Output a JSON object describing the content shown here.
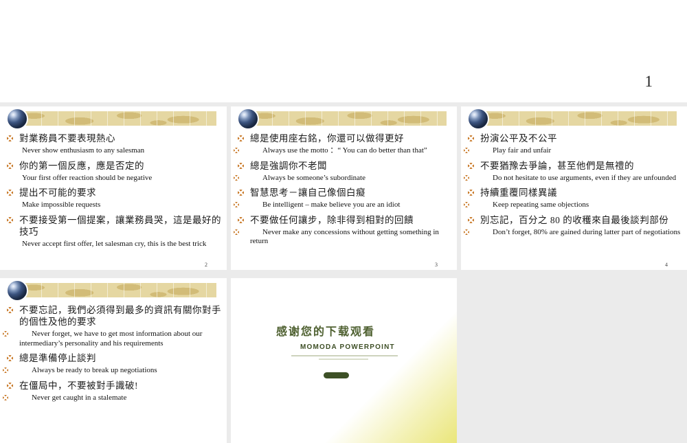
{
  "page": {
    "top_page_number": "1",
    "background_color": "#ebebeb"
  },
  "slides": [
    {
      "page_number": "2",
      "english_bullets": false,
      "items": [
        {
          "zh": "對業務員不要表現熱心",
          "en": "Never show enthusiasm to any salesman"
        },
        {
          "zh": "你的第一個反應，應是否定的",
          "en": "Your first offer reaction should be negative"
        },
        {
          "zh": "提出不可能的要求",
          "en": "Make impossible requests"
        },
        {
          "zh": "不要接受第一個提案，讓業務員哭，這是最好的技巧",
          "en": "Never accept first offer, let salesman cry, this is the best trick"
        }
      ]
    },
    {
      "page_number": "3",
      "english_bullets": true,
      "items": [
        {
          "zh": "總是使用座右銘，你還可以做得更好",
          "en": "Always use the motto ：“ You can do better than that”"
        },
        {
          "zh": "總是強調你不老闆",
          "en": "Always be someone’s subordinate"
        },
        {
          "zh": "智慧思考－讓自己像個白癡",
          "en": "Be intelligent – make believe you are an idiot"
        },
        {
          "zh": "不要做任何讓步，除非得到相對的回饋",
          "en": "Never make any concessions without getting something in return"
        }
      ]
    },
    {
      "page_number": "4",
      "english_bullets": true,
      "items": [
        {
          "zh": "扮演公平及不公平",
          "en": "Play fair and unfair"
        },
        {
          "zh": "不要猶豫去爭論，甚至他們是無禮的",
          "en": "Do not hesitate to use arguments, even if they are unfounded"
        },
        {
          "zh": "持續重覆同樣異議",
          "en": "Keep repeating same objections"
        },
        {
          "zh": "別忘記，百分之 80 的收穫來自最後談判部份",
          "en": "Don’t forget, 80% are gained during latter part of negotiations"
        }
      ]
    },
    {
      "page_number": "",
      "english_bullets": true,
      "items": [
        {
          "zh": "不要忘記，我們必須得到最多的資訊有關你對手的個性及他的要求",
          "en": "Never forget, we have to get most information about our intermediary’s personality and his requirements"
        },
        {
          "zh": "總是準備停止談判",
          "en": "Always be ready to break up negotiations"
        },
        {
          "zh": "在僵局中，不要被對手識破!",
          "en": "Never get caught in a stalemate"
        }
      ]
    }
  ],
  "thanks_slide": {
    "title": "感谢您的下载观看",
    "subtitle": "MOMODA POWERPOINT"
  },
  "colors": {
    "banner_tan": "#e5d7a2",
    "banner_map": "#d2bc78",
    "bullet_orange": "#c8731c",
    "thanks_green": "#4e6030",
    "corner_yellow": "#eae67a"
  }
}
